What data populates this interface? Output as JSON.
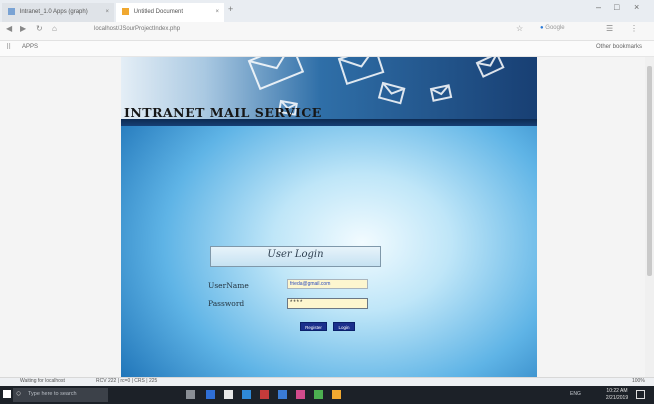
{
  "browser": {
    "tabs": [
      {
        "label": "Intranet_1.0 Apps (graph)"
      },
      {
        "label": "Untitled Document"
      }
    ],
    "url": "localhost/JSourProjectIndex.php",
    "search_placeholder": "Google",
    "bookmarks_left": "APPS",
    "bookmarks_right": "Other bookmarks"
  },
  "page": {
    "title": "INTRANET MAIL SERVICE",
    "login": {
      "header": "User Login",
      "username_label": "UserName",
      "username_value": "frieda@gmail.com",
      "password_label": "Password",
      "password_value": "****",
      "register_label": "Register",
      "login_label": "Login"
    }
  },
  "statusbar": {
    "left": "Waiting for localhost",
    "mid": "RCV 222 | rc=0 | CRS | 225",
    "right": "100%"
  },
  "taskbar": {
    "search_placeholder": "Type here to search",
    "tray": "ENG",
    "time": "10:22 AM",
    "date": "2/21/2019"
  },
  "colors": {
    "page_bg_dark": "#1f74b8",
    "button_bg": "#1b2f8c",
    "field_bg": "#fdf6cf",
    "taskbar_bg": "#1c2128"
  },
  "icons": [
    "envelope-icon",
    "search-icon",
    "windows-start-icon",
    "gear-icon",
    "star-icon"
  ]
}
